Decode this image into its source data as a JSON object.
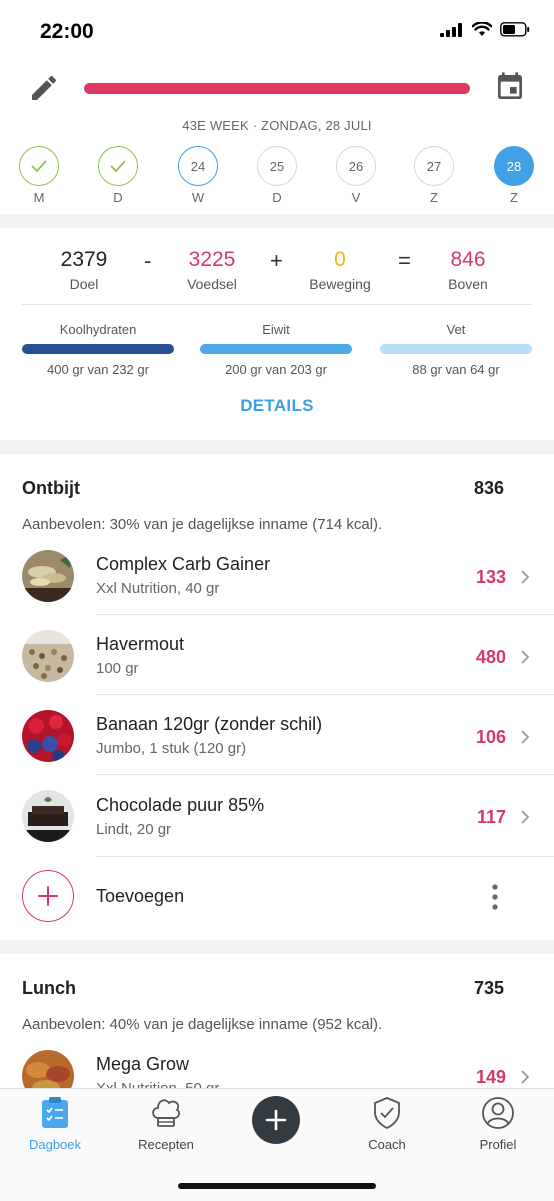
{
  "status": {
    "time": "22:00"
  },
  "header": {
    "week_line": "43E WEEK   ·   ZONDAG, 28 JULI",
    "days": [
      {
        "letter": "M",
        "num": "",
        "state": "check"
      },
      {
        "letter": "D",
        "num": "",
        "state": "check"
      },
      {
        "letter": "W",
        "num": "24",
        "state": "today-outline"
      },
      {
        "letter": "D",
        "num": "25",
        "state": "plain"
      },
      {
        "letter": "V",
        "num": "26",
        "state": "plain"
      },
      {
        "letter": "Z",
        "num": "27",
        "state": "plain"
      },
      {
        "letter": "Z",
        "num": "28",
        "state": "active"
      }
    ]
  },
  "summary": {
    "goal_value": "2379",
    "goal_label": "Doel",
    "food_value": "3225",
    "food_label": "Voedsel",
    "exercise_value": "0",
    "exercise_label": "Beweging",
    "remaining_value": "846",
    "remaining_label": "Boven",
    "op_minus": "-",
    "op_plus": "+",
    "op_equals": "=",
    "macros": [
      {
        "label": "Koolhydraten",
        "value": "400 gr van 232 gr",
        "color": "#274f95"
      },
      {
        "label": "Eiwit",
        "value": "200 gr van 203 gr",
        "color": "#4ea8ea"
      },
      {
        "label": "Vet",
        "value": "88 gr van 64 gr",
        "color": "#b7def7"
      }
    ],
    "details": "DETAILS"
  },
  "breakfast": {
    "title": "Ontbijt",
    "kcal": "836",
    "note": "Aanbevolen: 30% van je dagelijkse inname (714 kcal).",
    "items": [
      {
        "name": "Complex Carb Gainer",
        "sub": "Xxl Nutrition, 40 gr",
        "kcal": "133"
      },
      {
        "name": "Havermout",
        "sub": "100 gr",
        "kcal": "480"
      },
      {
        "name": "Banaan 120gr (zonder schil)",
        "sub": "Jumbo, 1 stuk (120 gr)",
        "kcal": "106"
      },
      {
        "name": "Chocolade puur 85%",
        "sub": "Lindt, 20 gr",
        "kcal": "117"
      }
    ],
    "add_label": "Toevoegen"
  },
  "lunch": {
    "title": "Lunch",
    "kcal": "735",
    "note": "Aanbevolen: 40% van je dagelijkse inname (952 kcal).",
    "items": [
      {
        "name": "Mega Grow",
        "sub": "Xxl Nutrition, 50 gr",
        "kcal": "149"
      }
    ]
  },
  "tabs": {
    "diary": "Dagboek",
    "recipes": "Recepten",
    "coach": "Coach",
    "profile": "Profiel",
    "active_color": "#3f9fe4"
  }
}
